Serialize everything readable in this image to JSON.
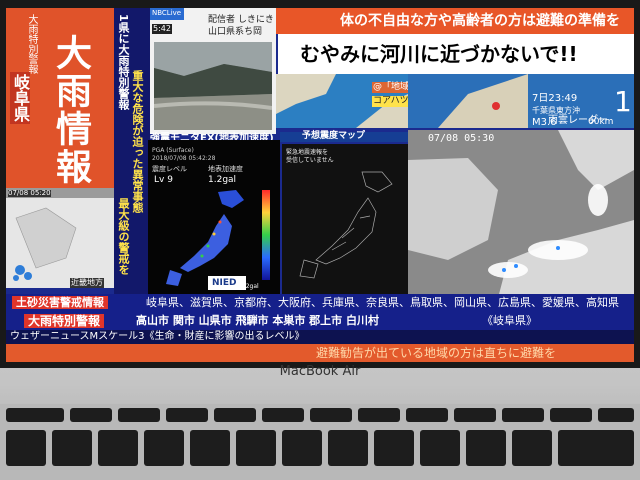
{
  "left": {
    "region_header": "大雨特別警報",
    "prefecture": "岐阜県",
    "big_title": "大雨情報",
    "map_time": "07/08 05:20",
    "region_label": "近畿地方"
  },
  "vertical": {
    "line1": "1県に大雨特別警報",
    "line2": "重大な危険が迫った異常事態",
    "line3": "最大級の警戒を"
  },
  "camera": {
    "channel": "NBCLive",
    "time": "5:42",
    "caption": "配信者 しきにき",
    "location": "山口県系ち岡"
  },
  "top_ticker": "体の不自由な方や高齢者の方は避難の準備を",
  "warning": "むやみに河川に近づかないで!!",
  "smallmap": {
    "line1": "@「地域名」",
    "line2": "コアハツ可"
  },
  "earthquake": {
    "time": "7日23:49",
    "place": "千葉県東方沖",
    "magnitude": "M3.6",
    "depth": "60km",
    "intensity": "1"
  },
  "shindo_monitor": {
    "title": "強震モニタEX(地表加速度)",
    "line1": "PGA (Surface)",
    "line2": "2018/07/08 05:42:28",
    "label_a": "震度レベル",
    "label_b": "地表加速度",
    "level": "Lv 9",
    "accel": "1.2gal",
    "scale_label": "1.2gal",
    "logo": "NIED"
  },
  "yoso": {
    "title": "予想震度マップ",
    "note_line1": "緊急地震速報を",
    "note_line2": "受信していません"
  },
  "radar": {
    "title": "雨雲レーダー",
    "time": "07/08 05:30"
  },
  "row1": {
    "badge": "土砂災害警戒情報",
    "prefs": "岐阜県、滋賀県、京都府、大阪府、兵庫県、奈良県、鳥取県、岡山県、広島県、愛媛県、高知県"
  },
  "row2": {
    "badge": "大雨特別警報",
    "cities": "高山市 関市 山県市 飛騨市 本巣市 郡上市 白川村",
    "pref_tag": "《岐阜県》"
  },
  "row3": {
    "text": "ウェザーニュースMスケール3《生命・財産に影響の出るレベル》"
  },
  "bottom_ticker": "避難勧告が出ている地域の方は直ちに避難を",
  "laptop_brand": "MacBook Air"
}
